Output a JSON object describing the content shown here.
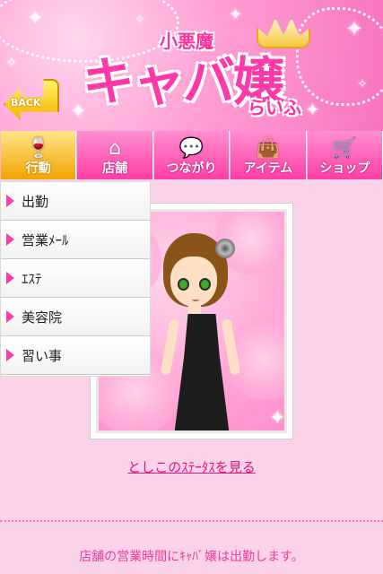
{
  "header": {
    "logo_sub": "小悪魔",
    "logo_main": "キャバ嬢",
    "logo_tail": "らいふ",
    "back_label": "BACK"
  },
  "nav": {
    "tabs": [
      {
        "label": "行動",
        "icon": "wine-glass-icon",
        "glyph": "🍷",
        "active": true
      },
      {
        "label": "店舗",
        "icon": "house-icon",
        "glyph": "⌂",
        "active": false
      },
      {
        "label": "つながり",
        "icon": "chat-bubble-icon",
        "glyph": "💬",
        "active": false
      },
      {
        "label": "アイテム",
        "icon": "bag-icon",
        "glyph": "👜",
        "active": false
      },
      {
        "label": "ショップ",
        "icon": "cart-icon",
        "glyph": "🛒",
        "active": false
      }
    ]
  },
  "dropdown": {
    "items": [
      "出勤",
      "営業ﾒｰﾙ",
      "ｴｽﾃ",
      "美容院",
      "習い事"
    ]
  },
  "status_link": "としこのｽﾃｰﾀｽを見る",
  "info": {
    "line1": "店舗の営業時間にｷｬﾊﾞ嬢は出勤します。"
  },
  "colors": {
    "accent": "#ff3aa8",
    "background": "#fbd3e8",
    "active_tab": "#f3a400"
  }
}
